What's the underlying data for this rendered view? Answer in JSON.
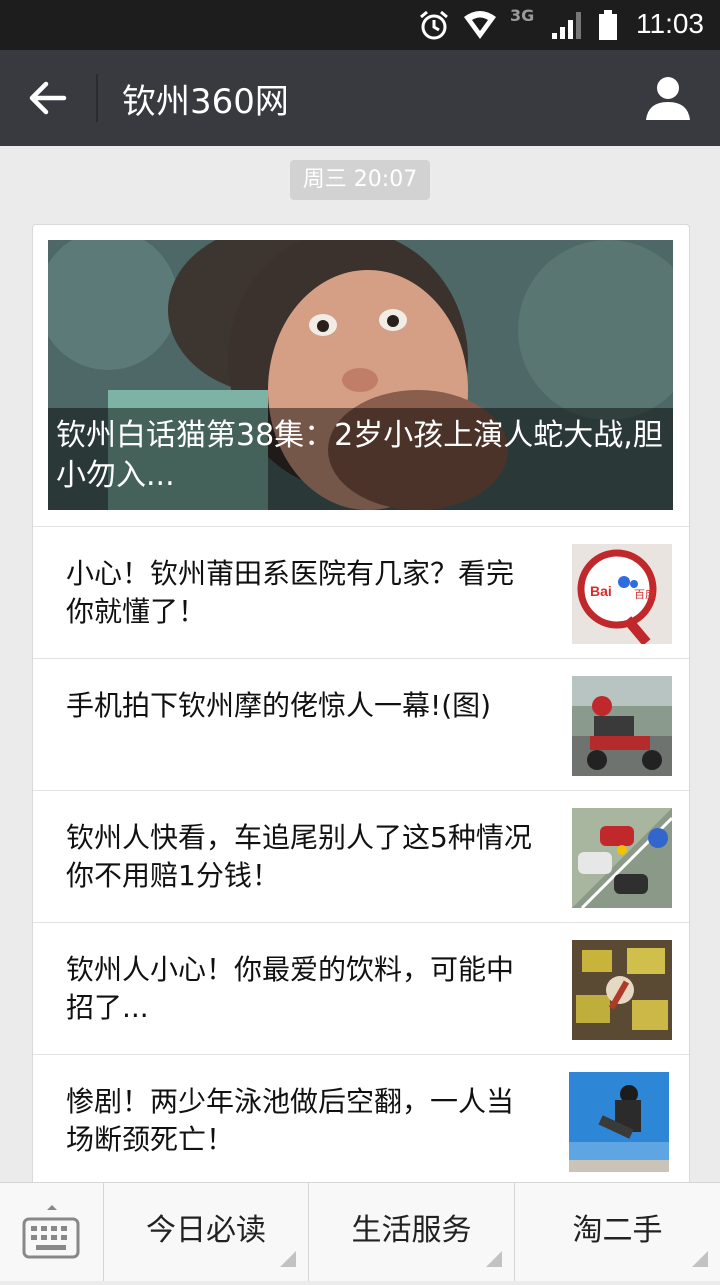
{
  "status_bar": {
    "time": "11:03",
    "network": "3G",
    "icons": [
      "alarm-icon",
      "wifi-icon",
      "signal-icon",
      "battery-icon"
    ]
  },
  "header": {
    "title": "钦州360网",
    "back_icon": "arrow-left-icon",
    "profile_icon": "person-icon"
  },
  "timestamp": "周三 20:07",
  "feed": {
    "cover": {
      "title": "钦州白话猫第38集：2岁小孩上演人蛇大战,胆小勿入..."
    },
    "items": [
      {
        "title": "小心！钦州莆田系医院有几家？看完你就懂了！",
        "thumb_text": "百度"
      },
      {
        "title": "手机拍下钦州摩的佬惊人一幕!(图)"
      },
      {
        "title": "钦州人快看，车追尾别人了这5种情况你不用赔1分钱！"
      },
      {
        "title": "钦州人小心！你最爱的饮料，可能中招了..."
      },
      {
        "title": "惨剧！两少年泳池做后空翻，一人当场断颈死亡！"
      }
    ]
  },
  "bottom_menu": {
    "keyboard_icon": "keyboard-icon",
    "items": [
      {
        "label": "今日必读"
      },
      {
        "label": "生活服务"
      },
      {
        "label": "淘二手"
      }
    ]
  },
  "colors": {
    "header_bg": "#393a3f",
    "status_bg": "#1d1d1d",
    "page_bg": "#ebebeb"
  }
}
